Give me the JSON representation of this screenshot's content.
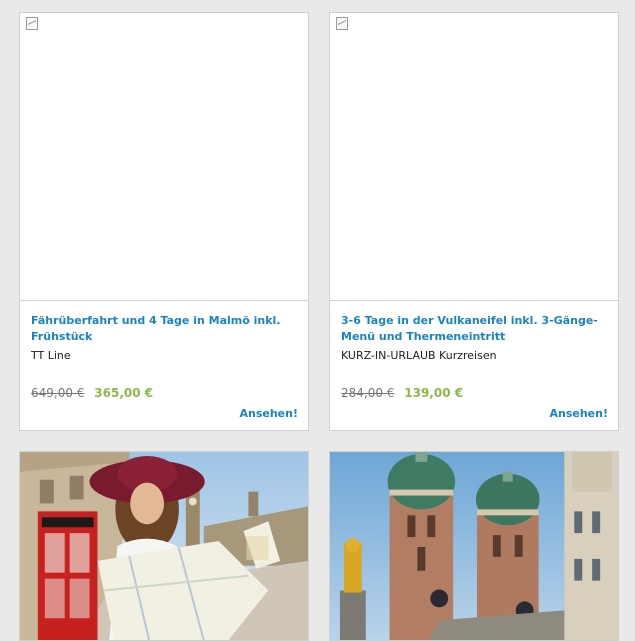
{
  "deals": [
    {
      "title": "Fähr­überfahrt und 4 Tage in Malmö inkl. Frühstück",
      "vendor": "TT Line",
      "old_price": "649,00 €",
      "new_price": "365,00 €",
      "cta": "Ansehen!"
    },
    {
      "title": "3-6 Tage in der Vulkaneifel inkl. 3-Gänge-Menü und Thermeneintritt",
      "vendor": "KURZ-IN-URLAUB Kurzreisen",
      "old_price": "284,00 €",
      "new_price": "139,00 €",
      "cta": "Ansehen!"
    }
  ],
  "colors": {
    "link": "#1a84c3",
    "price_new": "#8cb84a",
    "background": "#e9e9e9"
  }
}
